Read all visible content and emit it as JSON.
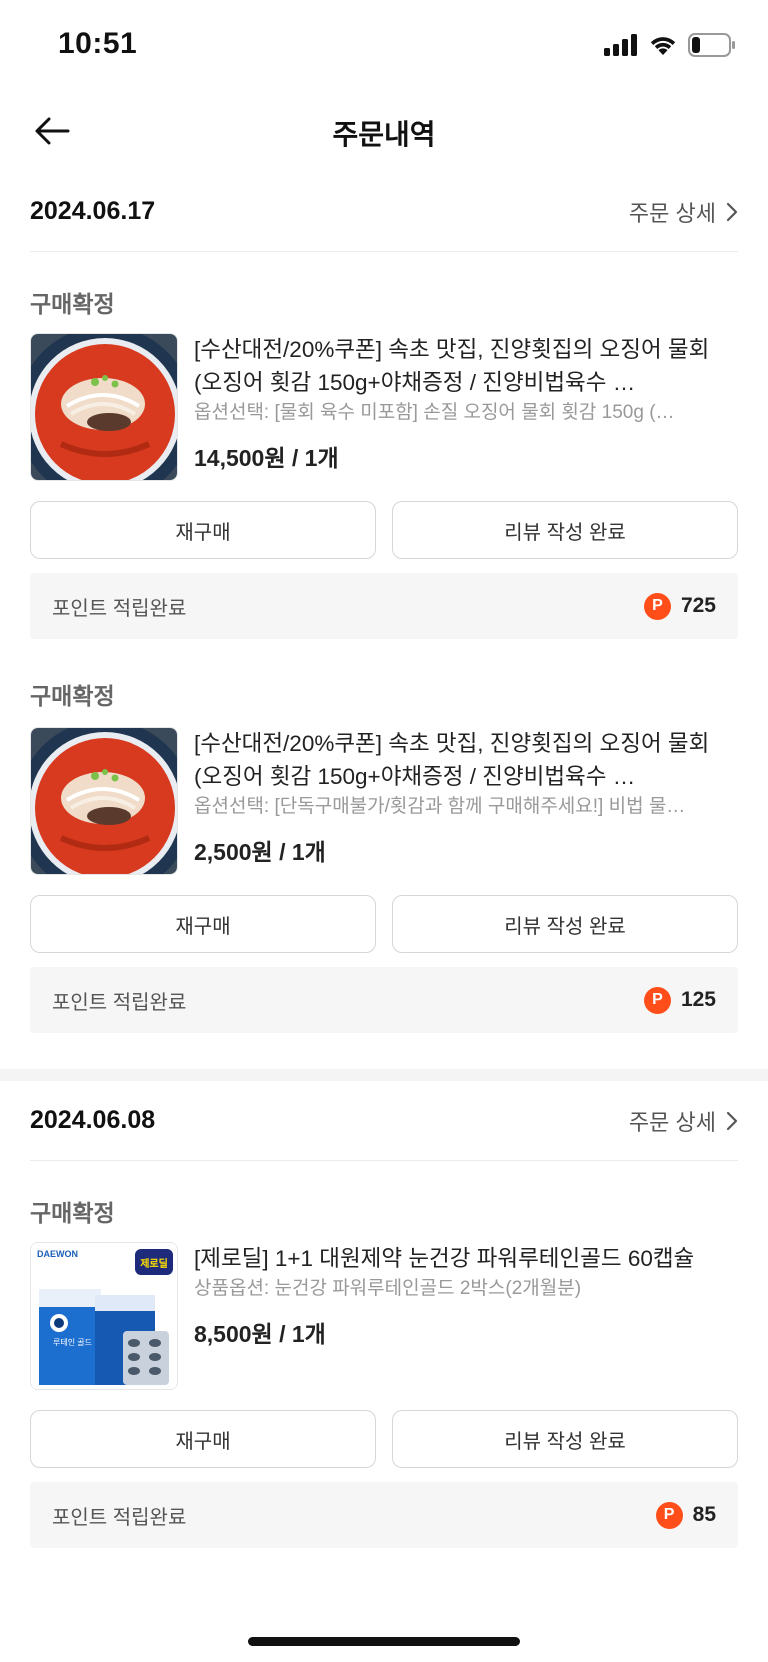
{
  "status_bar": {
    "time": "10:51"
  },
  "header": {
    "title": "주문내역"
  },
  "orders": [
    {
      "date": "2024.06.17",
      "detail_label": "주문 상세",
      "items": [
        {
          "status": "구매확정",
          "name": "[수산대전/20%쿠폰] 속초 맛집, 진양횟집의 오징어 물회 (오징어 횟감 150g+야채증정 / 진양비법육수 …",
          "option": "옵션선택: [물회 육수 미포함] 손질 오징어 물회 횟감 150g (…",
          "price": "14,500원 / 1개",
          "rebuy_label": "재구매",
          "review_label": "리뷰 작성 완료",
          "points_label": "포인트 적립완료",
          "points_badge": "P",
          "points_value": "725",
          "thumb_icon": "squid-mulhoe-image"
        },
        {
          "status": "구매확정",
          "name": "[수산대전/20%쿠폰] 속초 맛집, 진양횟집의 오징어 물회 (오징어 횟감 150g+야채증정 / 진양비법육수 …",
          "option": "옵션선택: [단독구매불가/횟감과 함께 구매해주세요!] 비법 물…",
          "price": "2,500원 / 1개",
          "rebuy_label": "재구매",
          "review_label": "리뷰 작성 완료",
          "points_label": "포인트 적립완료",
          "points_badge": "P",
          "points_value": "125",
          "thumb_icon": "squid-mulhoe-image"
        }
      ]
    },
    {
      "date": "2024.06.08",
      "detail_label": "주문 상세",
      "items": [
        {
          "status": "구매확정",
          "name": "[제로딜] 1+1 대원제약 눈건강 파워루테인골드 60캡슐",
          "option": "상품옵션: 눈건강 파워루테인골드 2박스(2개월분)",
          "price": "8,500원 / 1개",
          "rebuy_label": "재구매",
          "review_label": "리뷰 작성 완료",
          "points_label": "포인트 적립완료",
          "points_badge": "P",
          "points_value": "85",
          "thumb_icon": "lutein-product-image",
          "thumb_text": {
            "brand": "DAEWON",
            "badge": "제로딜",
            "product": "루테인 골드"
          }
        }
      ]
    }
  ],
  "colors": {
    "point_badge": "#ff4e1a",
    "points_bg": "#f6f6f6",
    "border": "#d6d6d6"
  }
}
